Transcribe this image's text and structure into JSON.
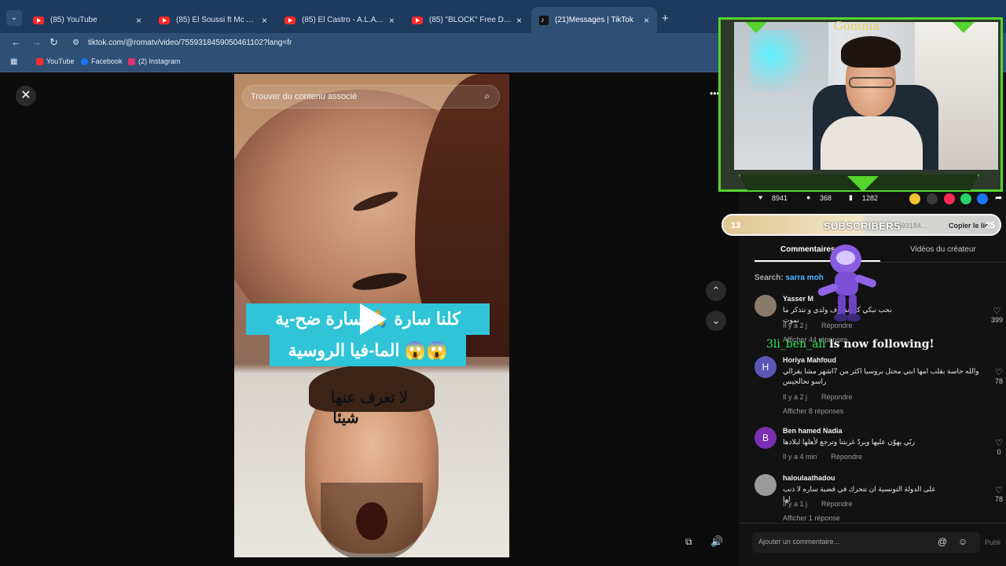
{
  "tabs": [
    {
      "label": "(85) YouTube",
      "icon": "youtube-icon"
    },
    {
      "label": "(85) El Soussi ft Mc Artisan - Ke",
      "icon": "youtube-icon"
    },
    {
      "label": "(85) El Castro - A.L.A - Rules / ...",
      "icon": "youtube-icon"
    },
    {
      "label": "(85) \"BLOCK\" Free Drill Hard Tr",
      "icon": "youtube-icon"
    },
    {
      "label": "(21)Messages | TikTok",
      "icon": "tiktok-icon"
    }
  ],
  "address_bar": {
    "url": "tiktok.com/@romatv/video/7559318459050461102?lang=fr"
  },
  "bookmarks": [
    {
      "label": "YouTube",
      "color": "#ff2a2a"
    },
    {
      "label": "Facebook",
      "color": "#1877f2"
    },
    {
      "label": "(2) Instagram",
      "color": "#e1306c"
    }
  ],
  "video": {
    "search_placeholder": "Trouver du contenu associé",
    "caption_line1": "كلنا سارة 🙏 سارة ضح-ية",
    "caption_line2": "الما-فيا الروسية 😱😱",
    "subtitle_line1": "لا تعرف عنها",
    "subtitle_line2": "شيئا"
  },
  "stats": {
    "likes": "8941",
    "comments": "368",
    "shares": "1282"
  },
  "subscriber_bar": {
    "left": "13",
    "label": "SUBSCRIBERS",
    "right": "25",
    "overlay": "75593184...",
    "copy": "Copier le lie"
  },
  "stream": {
    "brand": "Gomma",
    "follow_user": "3li_ben_ali",
    "follow_text": " is now following!"
  },
  "panel": {
    "tab_comments": "Commentaires",
    "tab_creator": "Vidéos du créateur",
    "search_label": "Search:",
    "search_value": "sarra moh"
  },
  "comments": [
    {
      "name": "Yasser M",
      "text": "نحب نبكي كي نشوف ولدي و نتذكر ما نموت",
      "time": "Il y a 2 j",
      "reply": "Répondre",
      "likes": "399",
      "replies": "Afficher 44 réponses",
      "avatar": "#8a7a6a",
      "initial": ""
    },
    {
      "name": "Horiya Mahfoud",
      "text": "والله حاسة بقلب امها ابني محتل بروسيا اكثر من 7اشهر مشا يقرالي راسو تحالجيس",
      "time": "Il y a 2 j",
      "reply": "Répondre",
      "likes": "78",
      "replies": "Afficher 8 réponses",
      "avatar": "#5b56b6",
      "initial": "H"
    },
    {
      "name": "Ben hamed Nadia",
      "text": "ربّي يهوّن عليها ويردّ غربتنا وترجع لأهلها لبلادها",
      "time": "Il y a 4 min",
      "reply": "Répondre",
      "likes": "0",
      "replies": "",
      "avatar": "#7b2fb3",
      "initial": "B"
    },
    {
      "name": "haloulaathadou",
      "text": "على الدولة التونسية ان تتحرك في قضية ساره لا ذنب لها",
      "time": "Il y a 1 j",
      "reply": "Répondre",
      "likes": "78",
      "replies": "Afficher 1 réponse",
      "avatar": "#9a9a9a",
      "initial": ""
    }
  ],
  "comment_input": {
    "placeholder": "Ajouter un commentaire...",
    "post": "Publi"
  }
}
